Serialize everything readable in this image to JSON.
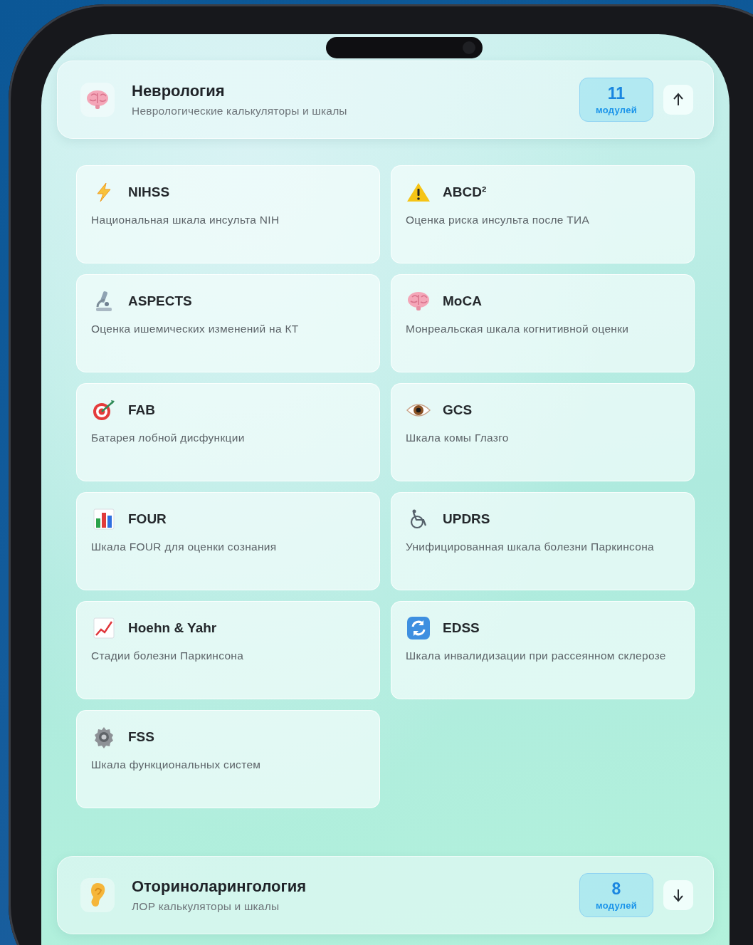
{
  "sections": [
    {
      "title": "Неврология",
      "subtitle": "Неврологические калькуляторы и шкалы",
      "count": "11",
      "count_label": "модулей",
      "expanded": true,
      "modules": [
        {
          "name": "NIHSS",
          "description": "Национальная шкала инсульта NIH"
        },
        {
          "name": "ABCD²",
          "description": "Оценка риска инсульта после ТИА"
        },
        {
          "name": "ASPECTS",
          "description": "Оценка ишемических изменений на КТ"
        },
        {
          "name": "MoCA",
          "description": "Монреальская шкала когнитивной оценки"
        },
        {
          "name": "FAB",
          "description": "Батарея лобной дисфункции"
        },
        {
          "name": "GCS",
          "description": "Шкала комы Глазго"
        },
        {
          "name": "FOUR",
          "description": "Шкала FOUR для оценки сознания"
        },
        {
          "name": "UPDRS",
          "description": "Унифицированная шкала болезни Паркинсона"
        },
        {
          "name": "Hoehn & Yahr",
          "description": "Стадии болезни Паркинсона"
        },
        {
          "name": "EDSS",
          "description": "Шкала инвалидизации при рассеянном склерозе"
        },
        {
          "name": "FSS",
          "description": "Шкала функциональных систем"
        }
      ]
    },
    {
      "title": "Оториноларингология",
      "subtitle": "ЛОР калькуляторы и шкалы",
      "count": "8",
      "count_label": "модулей",
      "expanded": false
    }
  ]
}
